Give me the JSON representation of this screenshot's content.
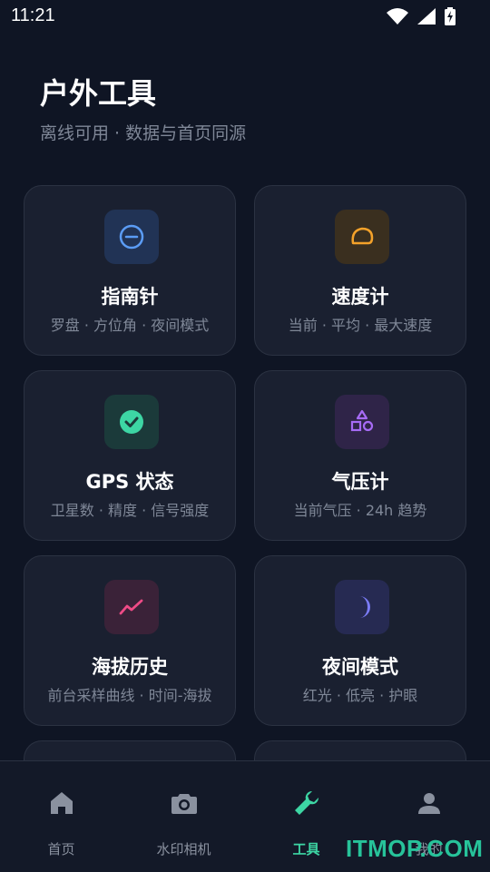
{
  "status_bar": {
    "time": "11:21"
  },
  "header": {
    "title": "户外工具",
    "subtitle": "离线可用 · 数据与首页同源"
  },
  "tools": [
    {
      "title": "指南针",
      "subtitle": "罗盘 · 方位角 · 夜间模式",
      "icon": "compass-icon",
      "accent": "#5b9cf5"
    },
    {
      "title": "速度计",
      "subtitle": "当前 · 平均 · 最大速度",
      "icon": "speedometer-icon",
      "accent": "#f4a22a"
    },
    {
      "title": "GPS 状态",
      "subtitle": "卫星数 · 精度 · 信号强度",
      "icon": "check-circle-icon",
      "accent": "#3dd6a4"
    },
    {
      "title": "气压计",
      "subtitle": "当前气压 · 24h 趋势",
      "icon": "shapes-icon",
      "accent": "#a66bf5"
    },
    {
      "title": "海拔历史",
      "subtitle": "前台采样曲线 · 时间-海拔",
      "icon": "trend-chart-icon",
      "accent": "#ef4b86"
    },
    {
      "title": "夜间模式",
      "subtitle": "红光 · 低亮 · 护眼",
      "icon": "moon-icon",
      "accent": "#7b7cf7"
    }
  ],
  "nav": {
    "items": [
      {
        "label": "首页",
        "icon": "home-icon"
      },
      {
        "label": "水印相机",
        "icon": "camera-icon"
      },
      {
        "label": "工具",
        "icon": "wrench-icon"
      },
      {
        "label": "我的",
        "icon": "person-icon"
      }
    ],
    "active": "工具"
  },
  "watermark": "ITMOP.COM",
  "colors": {
    "background": "#0f1524",
    "card": "#1a2030",
    "active_tab": "#3dd6a4"
  }
}
